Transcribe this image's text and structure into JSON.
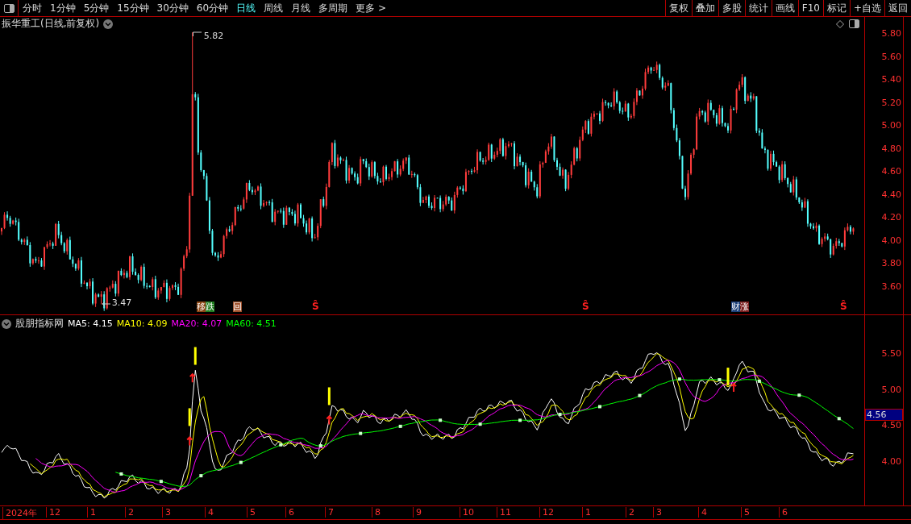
{
  "toolbar": {
    "periods": [
      {
        "label": "分时",
        "selected": false
      },
      {
        "label": "1分钟",
        "selected": false
      },
      {
        "label": "5分钟",
        "selected": false
      },
      {
        "label": "15分钟",
        "selected": false
      },
      {
        "label": "30分钟",
        "selected": false
      },
      {
        "label": "60分钟",
        "selected": false
      },
      {
        "label": "日线",
        "selected": true
      },
      {
        "label": "周线",
        "selected": false
      },
      {
        "label": "月线",
        "selected": false
      },
      {
        "label": "多周期",
        "selected": false
      }
    ],
    "more": "更多 >",
    "actions": [
      "复权",
      "叠加",
      "多股",
      "统计",
      "画线",
      "F10",
      "标记",
      "+自选",
      "返回"
    ]
  },
  "title": "振华重工(日线,前复权)",
  "main_chart": {
    "high_label": "5.82",
    "low_label": "3.47",
    "ticks": [
      "5.80",
      "5.60",
      "5.40",
      "5.20",
      "5.00",
      "4.80",
      "4.60",
      "4.40",
      "4.20",
      "4.00",
      "3.80",
      "3.60"
    ],
    "events": [
      {
        "kind": "badge",
        "parts": [
          {
            "text": "移",
            "color": "#8b4513"
          },
          {
            "text": "跌",
            "color": "#1e7d1e"
          }
        ]
      },
      {
        "kind": "badge",
        "parts": [
          {
            "text": "回",
            "color": "#a0522d"
          }
        ]
      },
      {
        "kind": "signal",
        "text": "Ŝ"
      },
      {
        "kind": "signal",
        "text": "Ŝ"
      },
      {
        "kind": "badge",
        "parts": [
          {
            "text": "财",
            "color": "#1c3f78"
          },
          {
            "text": "涨",
            "color": "#7a1c1c"
          }
        ]
      },
      {
        "kind": "signal",
        "text": "Ŝ"
      }
    ]
  },
  "indicator": {
    "name": "股朋指标网",
    "mas": [
      {
        "label": "MA5: 4.15",
        "color": "#ffffff"
      },
      {
        "label": "MA10: 4.09",
        "color": "#ffff00"
      },
      {
        "label": "MA20: 4.07",
        "color": "#ff00ff"
      },
      {
        "label": "MA60: 4.51",
        "color": "#00ff00"
      }
    ],
    "ticks": [
      "5.50",
      "5.00",
      "4.50",
      "4.00"
    ],
    "current": "4.56"
  },
  "time_axis": [
    "2024年",
    "12",
    "1",
    "2",
    "3",
    "4",
    "5",
    "6",
    "7",
    "8",
    "9",
    "10",
    "11",
    "12",
    "1",
    "2",
    "3",
    "4",
    "5",
    "6"
  ]
}
